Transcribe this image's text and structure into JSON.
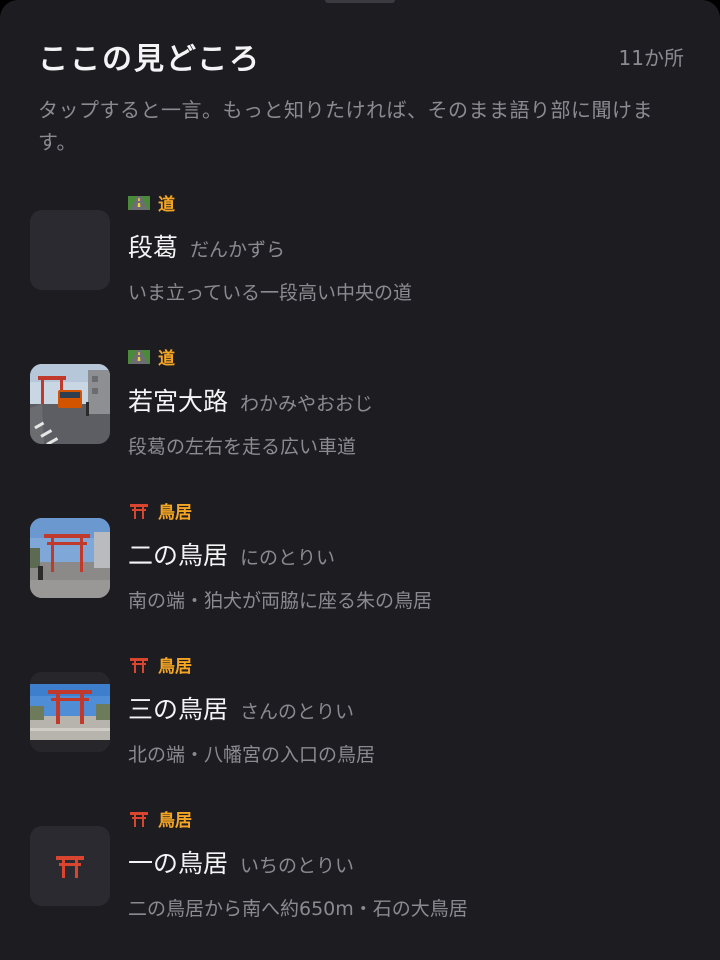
{
  "header": {
    "title": "ここの見どころ",
    "count": "11か所"
  },
  "intro": "タップすると一言。もっと知りたければ、そのまま語り部に聞けます。",
  "colors": {
    "background": "#1c1c21",
    "category": "#f5a524",
    "primary_text": "#f4f4f6",
    "secondary_text": "#8a8a90",
    "torii": "#d9452e"
  },
  "spots": [
    {
      "category_icon": "road-icon",
      "category": "道",
      "name": "段葛",
      "reading": "だんかずら",
      "description": "いま立っている一段高い中央の道",
      "thumbnail": "empty-placeholder"
    },
    {
      "category_icon": "road-icon",
      "category": "道",
      "name": "若宮大路",
      "reading": "わかみやおおじ",
      "description": "段葛の左右を走る広い車道",
      "thumbnail": "street-photo"
    },
    {
      "category_icon": "torii-icon",
      "category": "鳥居",
      "name": "二の鳥居",
      "reading": "にのとりい",
      "description": "南の端・狛犬が両脇に座る朱の鳥居",
      "thumbnail": "torii-photo-street"
    },
    {
      "category_icon": "torii-icon",
      "category": "鳥居",
      "name": "三の鳥居",
      "reading": "さんのとりい",
      "description": "北の端・八幡宮の入口の鳥居",
      "thumbnail": "torii-photo-plaza"
    },
    {
      "category_icon": "torii-icon",
      "category": "鳥居",
      "name": "一の鳥居",
      "reading": "いちのとりい",
      "description": "二の鳥居から南へ約650m・石の大鳥居",
      "thumbnail": "torii-icon-placeholder"
    }
  ]
}
